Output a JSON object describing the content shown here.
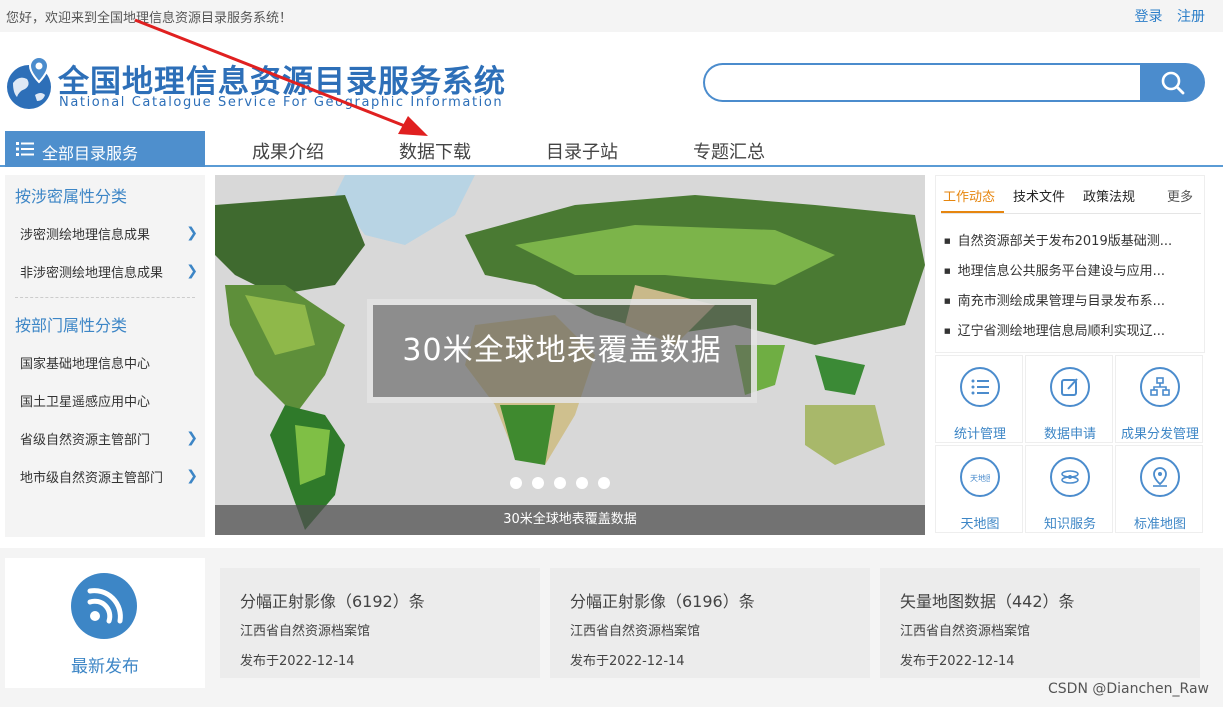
{
  "topbar": {
    "welcome": "您好，欢迎来到全国地理信息资源目录服务系统！",
    "login": "登录",
    "register": "注册"
  },
  "logo": {
    "title": "全国地理信息资源目录服务系统",
    "subtitle": "National Catalogue Service For Geographic Information"
  },
  "search": {
    "placeholder": "",
    "icon": "search-icon"
  },
  "nav": {
    "all_label": "全部目录服务",
    "tabs": [
      "成果介绍",
      "数据下载",
      "目录子站",
      "专题汇总"
    ]
  },
  "sidebar": {
    "section1": "按涉密属性分类",
    "items1": [
      {
        "label": "涉密测绘地理信息成果"
      },
      {
        "label": "非涉密测绘地理信息成果"
      }
    ],
    "section2": "按部门属性分类",
    "items2": [
      {
        "label": "国家基础地理信息中心"
      },
      {
        "label": "国土卫星遥感应用中心"
      },
      {
        "label": "省级自然资源主管部门"
      },
      {
        "label": "地市级自然资源主管部门"
      }
    ]
  },
  "banner": {
    "title": "30米全球地表覆盖数据",
    "caption": "30米全球地表覆盖数据",
    "slide_count": 5
  },
  "news": {
    "tabs": [
      "工作动态",
      "技术文件",
      "政策法规"
    ],
    "more": "更多",
    "items": [
      "自然资源部关于发布2019版基础测...",
      "地理信息公共服务平台建设与应用...",
      "南充市测绘成果管理与目录发布系...",
      "辽宁省测绘地理信息局顺利实现辽..."
    ],
    "accent_color": "#e6860f"
  },
  "services": [
    "统计管理",
    "数据申请",
    "成果分发管理",
    "天地图",
    "知识服务",
    "标准地图"
  ],
  "latest": {
    "label": "最新发布"
  },
  "cards": [
    {
      "title": "分幅正射影像（6192）条",
      "org": "江西省自然资源档案馆",
      "date": "发布于2022-12-14"
    },
    {
      "title": "分幅正射影像（6196）条",
      "org": "江西省自然资源档案馆",
      "date": "发布于2022-12-14"
    },
    {
      "title": "矢量地图数据（442）条",
      "org": "江西省自然资源档案馆",
      "date": "发布于2022-12-14"
    }
  ],
  "watermark": "CSDN @Dianchen_Raw",
  "colors": {
    "brand": "#2d6fb8",
    "accent_blue": "#4b8ccd",
    "annotation_arrow": "#e02020"
  }
}
